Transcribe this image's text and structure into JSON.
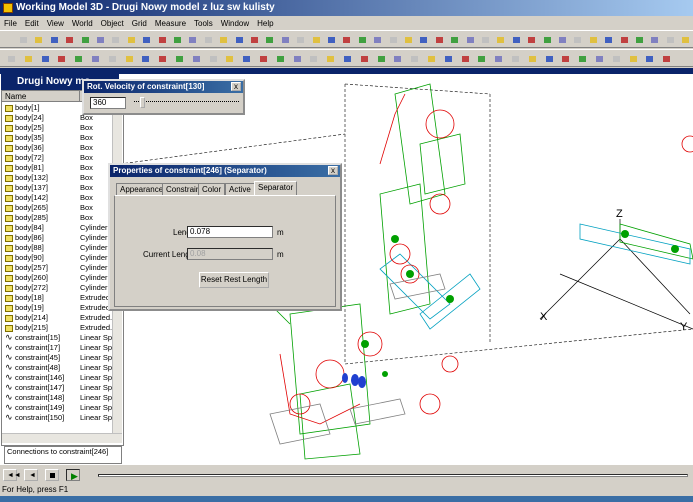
{
  "window": {
    "title": "Working Model 3D - Drugi Nowy model z luz sw kulisty"
  },
  "menu": [
    "File",
    "Edit",
    "View",
    "World",
    "Object",
    "Grid",
    "Measure",
    "Tools",
    "Window",
    "Help"
  ],
  "left_panel": {
    "title": "Drugi Nowy mo",
    "columns": [
      "Name",
      ""
    ],
    "rows": [
      {
        "name": "body[1]",
        "type": ""
      },
      {
        "name": "body[24]",
        "type": "Box"
      },
      {
        "name": "body[25]",
        "type": "Box"
      },
      {
        "name": "body[35]",
        "type": "Box"
      },
      {
        "name": "body[36]",
        "type": "Box"
      },
      {
        "name": "body[72]",
        "type": "Box"
      },
      {
        "name": "body[81]",
        "type": "Box"
      },
      {
        "name": "body[132]",
        "type": "Box"
      },
      {
        "name": "body[137]",
        "type": "Box"
      },
      {
        "name": "body[142]",
        "type": "Box"
      },
      {
        "name": "body[265]",
        "type": "Box"
      },
      {
        "name": "body[285]",
        "type": "Box"
      },
      {
        "name": "body[84]",
        "type": "Cylinder"
      },
      {
        "name": "body[86]",
        "type": "Cylinder"
      },
      {
        "name": "body[88]",
        "type": "Cylinder"
      },
      {
        "name": "body[90]",
        "type": "Cylinder"
      },
      {
        "name": "body[257]",
        "type": "Cylinder"
      },
      {
        "name": "body[260]",
        "type": "Cylinder"
      },
      {
        "name": "body[272]",
        "type": "Cylinder"
      },
      {
        "name": "body[18]",
        "type": "Extruded"
      },
      {
        "name": "body[19]",
        "type": "Extruded"
      },
      {
        "name": "body[214]",
        "type": "Extruded."
      },
      {
        "name": "body[215]",
        "type": "Extruded."
      },
      {
        "name": "constraint[15]",
        "type": "Linear Sp."
      },
      {
        "name": "constraint[17]",
        "type": "Linear Sp."
      },
      {
        "name": "constraint[45]",
        "type": "Linear Sp."
      },
      {
        "name": "constraint[48]",
        "type": "Linear Sp."
      },
      {
        "name": "constraint[146]",
        "type": "Linear Sp."
      },
      {
        "name": "constraint[147]",
        "type": "Linear Sp."
      },
      {
        "name": "constraint[148]",
        "type": "Linear Sp."
      },
      {
        "name": "constraint[149]",
        "type": "Linear Sp."
      },
      {
        "name": "constraint[150]",
        "type": "Linear Sp."
      }
    ],
    "connections_label": "Connections to constraint[246]"
  },
  "velocity_window": {
    "title": "Rot. Velocity of constraint[130]",
    "value": "360"
  },
  "properties_window": {
    "title": "Properties of constraint[246] (Separator)",
    "tabs": [
      "Appearance",
      "Constraint",
      "Color",
      "Active",
      "Separator"
    ],
    "active_tab": "Separator",
    "length_label": "Length",
    "length_value": "0.078",
    "length_unit": "m",
    "current_length_label": "Current Length",
    "current_length_value": "0.08",
    "current_length_unit": "m",
    "reset_button": "Reset Rest Length"
  },
  "status": {
    "text": "For Help, press F1"
  },
  "axis_labels": {
    "z": "Z",
    "x": "X",
    "y": "Y"
  },
  "colors": {
    "accent": "#0a246a",
    "model_green": "#00a000",
    "model_red": "#e00000",
    "model_blue": "#2040d0"
  }
}
